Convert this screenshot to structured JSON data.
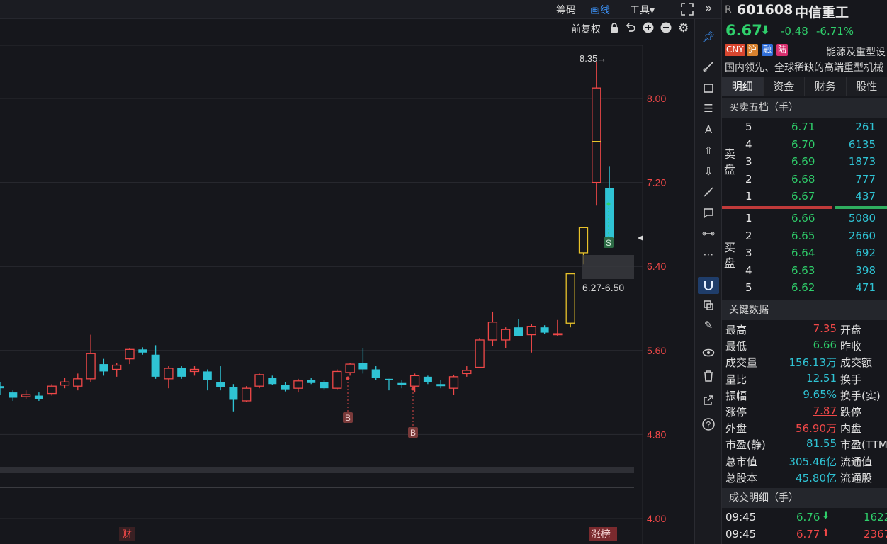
{
  "toolbar": {
    "chips": "筹码",
    "drawing": "画线",
    "tools": "工具▾",
    "fullscreen_icon": "fullscreen-icon",
    "expand_icon": "double-chevron-right-icon"
  },
  "subbar": {
    "adjust": "前复权"
  },
  "chart_data": {
    "type": "candlestick",
    "y_ticks": [
      "8.00",
      "7.20",
      "6.40",
      "5.60",
      "4.80",
      "4.00"
    ],
    "y_tick_values": [
      8.0,
      7.2,
      6.4,
      5.6,
      4.8,
      4.0
    ],
    "ylim": [
      4.0,
      8.6
    ],
    "high_label": "8.35→",
    "range_label": "6.27-6.50",
    "range_low": 6.27,
    "range_high": 6.5,
    "marker_b": "B",
    "marker_s": "S",
    "bottom_left_tag": "财",
    "bottom_right_tag": "涨榜",
    "candles": [
      {
        "o": 5.26,
        "c": 5.24,
        "h": 5.3,
        "l": 5.18
      },
      {
        "o": 5.2,
        "c": 5.15,
        "h": 5.22,
        "l": 5.12
      },
      {
        "o": 5.16,
        "c": 5.18,
        "h": 5.22,
        "l": 5.14
      },
      {
        "o": 5.17,
        "c": 5.14,
        "h": 5.2,
        "l": 5.12
      },
      {
        "o": 5.19,
        "c": 5.26,
        "h": 5.28,
        "l": 5.17
      },
      {
        "o": 5.27,
        "c": 5.3,
        "h": 5.34,
        "l": 5.24
      },
      {
        "o": 5.26,
        "c": 5.33,
        "h": 5.38,
        "l": 5.22
      },
      {
        "o": 5.33,
        "c": 5.57,
        "h": 5.75,
        "l": 5.3
      },
      {
        "o": 5.47,
        "c": 5.4,
        "h": 5.52,
        "l": 5.36
      },
      {
        "o": 5.42,
        "c": 5.46,
        "h": 5.48,
        "l": 5.35
      },
      {
        "o": 5.52,
        "c": 5.61,
        "h": 5.62,
        "l": 5.47
      },
      {
        "o": 5.61,
        "c": 5.58,
        "h": 5.63,
        "l": 5.56
      },
      {
        "o": 5.56,
        "c": 5.35,
        "h": 5.65,
        "l": 5.33
      },
      {
        "o": 5.33,
        "c": 5.43,
        "h": 5.45,
        "l": 5.24
      },
      {
        "o": 5.43,
        "c": 5.35,
        "h": 5.45,
        "l": 5.33
      },
      {
        "o": 5.4,
        "c": 5.42,
        "h": 5.45,
        "l": 5.36
      },
      {
        "o": 5.4,
        "c": 5.32,
        "h": 5.42,
        "l": 5.22
      },
      {
        "o": 5.3,
        "c": 5.25,
        "h": 5.45,
        "l": 5.22
      },
      {
        "o": 5.25,
        "c": 5.13,
        "h": 5.28,
        "l": 5.02
      },
      {
        "o": 5.12,
        "c": 5.24,
        "h": 5.26,
        "l": 5.11
      },
      {
        "o": 5.26,
        "c": 5.37,
        "h": 5.38,
        "l": 5.24
      },
      {
        "o": 5.34,
        "c": 5.28,
        "h": 5.36,
        "l": 5.27
      },
      {
        "o": 5.27,
        "c": 5.23,
        "h": 5.3,
        "l": 5.21
      },
      {
        "o": 5.24,
        "c": 5.31,
        "h": 5.33,
        "l": 5.2
      },
      {
        "o": 5.32,
        "c": 5.29,
        "h": 5.34,
        "l": 5.28
      },
      {
        "o": 5.3,
        "c": 5.24,
        "h": 5.32,
        "l": 5.23
      },
      {
        "o": 5.24,
        "c": 5.4,
        "h": 5.42,
        "l": 5.23
      },
      {
        "o": 5.39,
        "c": 5.47,
        "h": 5.48,
        "l": 5.36
      },
      {
        "o": 5.48,
        "c": 5.42,
        "h": 5.62,
        "l": 5.38
      },
      {
        "o": 5.42,
        "c": 5.34,
        "h": 5.45,
        "l": 5.32
      },
      {
        "o": 5.33,
        "c": 5.32,
        "h": 5.33,
        "l": 5.22
      },
      {
        "o": 5.29,
        "c": 5.27,
        "h": 5.32,
        "l": 5.24
      },
      {
        "o": 5.26,
        "c": 5.36,
        "h": 5.38,
        "l": 5.2
      },
      {
        "o": 5.35,
        "c": 5.3,
        "h": 5.36,
        "l": 5.28
      },
      {
        "o": 5.28,
        "c": 5.26,
        "h": 5.32,
        "l": 5.24
      },
      {
        "o": 5.24,
        "c": 5.35,
        "h": 5.37,
        "l": 5.18
      },
      {
        "o": 5.38,
        "c": 5.41,
        "h": 5.45,
        "l": 5.35
      },
      {
        "o": 5.44,
        "c": 5.7,
        "h": 5.72,
        "l": 5.43
      },
      {
        "o": 5.7,
        "c": 5.87,
        "h": 5.97,
        "l": 5.64
      },
      {
        "o": 5.7,
        "c": 5.8,
        "h": 5.82,
        "l": 5.62
      },
      {
        "o": 5.82,
        "c": 5.74,
        "h": 5.9,
        "l": 5.74
      },
      {
        "o": 5.75,
        "c": 5.83,
        "h": 5.85,
        "l": 5.58
      },
      {
        "o": 5.82,
        "c": 5.77,
        "h": 5.84,
        "l": 5.76
      },
      {
        "o": 5.75,
        "c": 5.76,
        "h": 5.89,
        "l": 5.74
      },
      {
        "o": 5.86,
        "c": 6.33,
        "h": 6.33,
        "l": 5.82
      },
      {
        "o": 6.53,
        "c": 6.77,
        "h": 6.77,
        "l": 6.42
      },
      {
        "o": 7.2,
        "c": 8.1,
        "h": 8.35,
        "l": 6.98
      },
      {
        "o": 7.15,
        "c": 6.67,
        "h": 7.35,
        "l": 6.66
      }
    ]
  },
  "panel": {
    "badge": "R",
    "code": "601608",
    "name": "中信重工",
    "price": "6.67",
    "arrow": "⬇",
    "change": "-0.48",
    "change_pct": "-6.71%",
    "tags": [
      "CNY",
      "沪",
      "融",
      "陆"
    ],
    "industry": "能源及重型设",
    "description": "国内领先、全球稀缺的高端重型机械",
    "tabs": [
      "明细",
      "资金",
      "财务",
      "股性"
    ],
    "orderbook_title": "买卖五档（手）",
    "sell_label": "卖盘",
    "buy_label": "买盘",
    "asks": [
      {
        "level": "5",
        "price": "6.71",
        "vol": "261"
      },
      {
        "level": "4",
        "price": "6.70",
        "vol": "6135"
      },
      {
        "level": "3",
        "price": "6.69",
        "vol": "1873"
      },
      {
        "level": "2",
        "price": "6.68",
        "vol": "777"
      },
      {
        "level": "1",
        "price": "6.67",
        "vol": "437"
      }
    ],
    "bids": [
      {
        "level": "1",
        "price": "6.66",
        "vol": "5080"
      },
      {
        "level": "2",
        "price": "6.65",
        "vol": "2660"
      },
      {
        "level": "3",
        "price": "6.64",
        "vol": "692"
      },
      {
        "level": "4",
        "price": "6.63",
        "vol": "398"
      },
      {
        "level": "5",
        "price": "6.62",
        "vol": "471"
      }
    ],
    "keydata_title": "关键数据",
    "keydata": [
      {
        "label": "最高",
        "value": "7.35",
        "color": "#f04848",
        "label2": "开盘"
      },
      {
        "label": "最低",
        "value": "6.66",
        "color": "#2fcf6b",
        "label2": "昨收"
      },
      {
        "label": "成交量",
        "value": "156.13万",
        "color": "#2fc3d4",
        "label2": "成交额"
      },
      {
        "label": "量比",
        "value": "12.51",
        "color": "#2fc3d4",
        "label2": "换手"
      },
      {
        "label": "振幅",
        "value": "9.65%",
        "color": "#2fc3d4",
        "label2": "换手(实)"
      },
      {
        "label": "涨停",
        "value": "7.87",
        "color": "#f04848",
        "label2": "跌停"
      },
      {
        "label": "外盘",
        "value": "56.90万",
        "color": "#f04848",
        "label2": "内盘"
      },
      {
        "label": "市盈(静)",
        "value": "81.55",
        "color": "#2fc3d4",
        "label2": "市盈(TTM"
      },
      {
        "label": "总市值",
        "value": "305.46亿",
        "color": "#2fc3d4",
        "label2": "流通值"
      },
      {
        "label": "总股本",
        "value": "45.80亿",
        "color": "#2fc3d4",
        "label2": "流通股"
      }
    ],
    "trades_title": "成交明细（手）",
    "trades": [
      {
        "time": "09:45",
        "price": "6.76",
        "arrow": "⬇",
        "vol": "1622",
        "dir": "down"
      },
      {
        "time": "09:45",
        "price": "6.77",
        "arrow": "⬆",
        "vol": "2367",
        "dir": "up"
      }
    ]
  }
}
